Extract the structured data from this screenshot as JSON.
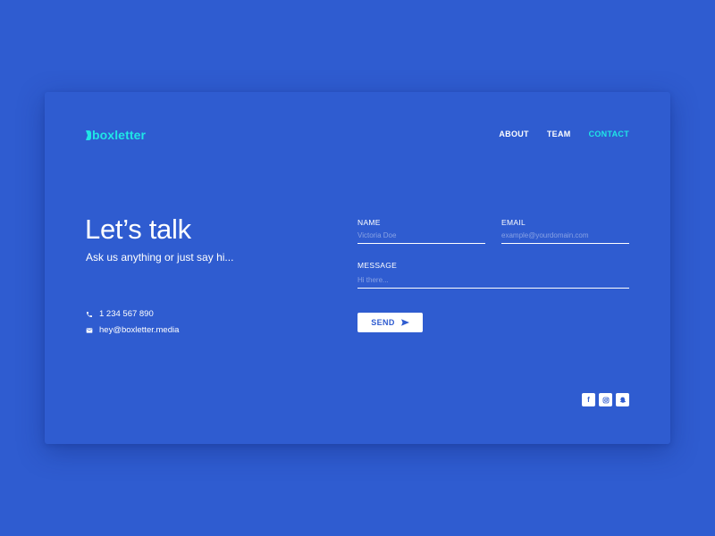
{
  "brand": {
    "name": "boxletter",
    "accent_color": "#1FE6E6",
    "background_color": "#2F5CD0"
  },
  "nav": {
    "items": [
      {
        "label": "ABOUT",
        "active": false
      },
      {
        "label": "TEAM",
        "active": false
      },
      {
        "label": "CONTACT",
        "active": true
      }
    ]
  },
  "hero": {
    "title": "Let’s talk",
    "subtitle": "Ask us anything or just say hi..."
  },
  "contact": {
    "phone": "1 234 567 890",
    "phone_icon": "phone-icon",
    "email": "hey@boxletter.media",
    "email_icon": "mail-icon"
  },
  "form": {
    "name": {
      "label": "NAME",
      "placeholder": "Victoria Doe",
      "value": ""
    },
    "email": {
      "label": "EMAIL",
      "placeholder": "example@yourdomain.com",
      "value": ""
    },
    "message": {
      "label": "MESSAGE",
      "placeholder": "Hi there...",
      "value": ""
    },
    "send": {
      "label": "SEND",
      "icon": "send-icon"
    }
  },
  "socials": [
    {
      "name": "facebook-icon",
      "glyph": "f"
    },
    {
      "name": "instagram-icon",
      "glyph": ""
    },
    {
      "name": "snapchat-icon",
      "glyph": ""
    }
  ]
}
